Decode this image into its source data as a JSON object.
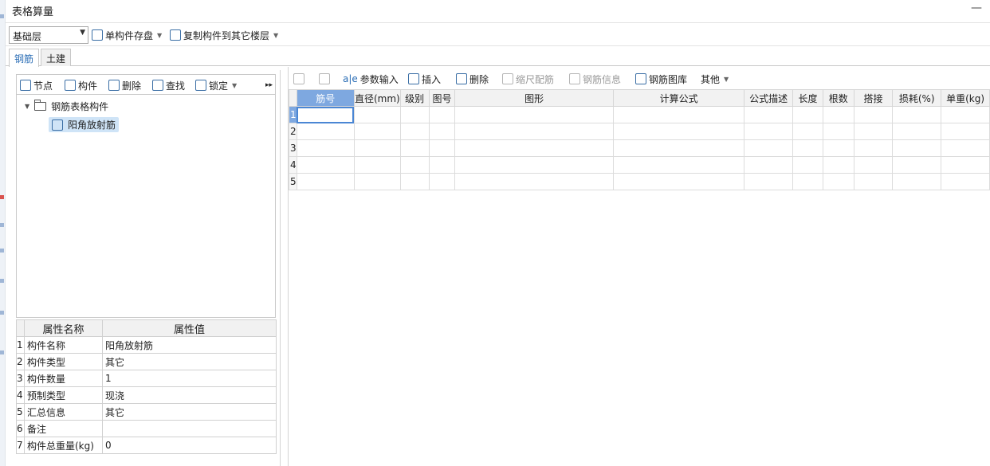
{
  "window": {
    "title": "表格算量",
    "minimize": "—"
  },
  "toolbar": {
    "floor_select": "基础层",
    "save_label": "单构件存盘",
    "copy_label": "复制构件到其它楼层"
  },
  "tabs": [
    {
      "label": "钢筋"
    },
    {
      "label": "土建"
    }
  ],
  "left_toolbar": {
    "node": "节点",
    "component": "构件",
    "delete": "删除",
    "find": "查找",
    "lock": "锁定",
    "more": "▸▸"
  },
  "tree": {
    "root": "钢筋表格构件",
    "child": "阳角放射筋"
  },
  "properties": {
    "headers": [
      "属性名称",
      "属性值"
    ],
    "rows": [
      {
        "n": "1",
        "name": "构件名称",
        "value": "阳角放射筋"
      },
      {
        "n": "2",
        "name": "构件类型",
        "value": "其它"
      },
      {
        "n": "3",
        "name": "构件数量",
        "value": "1"
      },
      {
        "n": "4",
        "name": "预制类型",
        "value": "现浇"
      },
      {
        "n": "5",
        "name": "汇总信息",
        "value": "其它"
      },
      {
        "n": "6",
        "name": "备注",
        "value": ""
      },
      {
        "n": "7",
        "name": "构件总重量(kg)",
        "value": "0"
      }
    ]
  },
  "grid_toolbar": {
    "param_input": "参数输入",
    "insert": "插入",
    "delete": "删除",
    "scale_rebar": "缩尺配筋",
    "rebar_info": "钢筋信息",
    "rebar_library": "钢筋图库",
    "other": "其他"
  },
  "grid": {
    "columns": [
      "筋号",
      "直径(mm)",
      "级别",
      "图号",
      "图形",
      "计算公式",
      "公式描述",
      "长度",
      "根数",
      "搭接",
      "损耗(%)",
      "单重(kg)"
    ],
    "rows": [
      "1",
      "2",
      "3",
      "4",
      "5"
    ]
  }
}
